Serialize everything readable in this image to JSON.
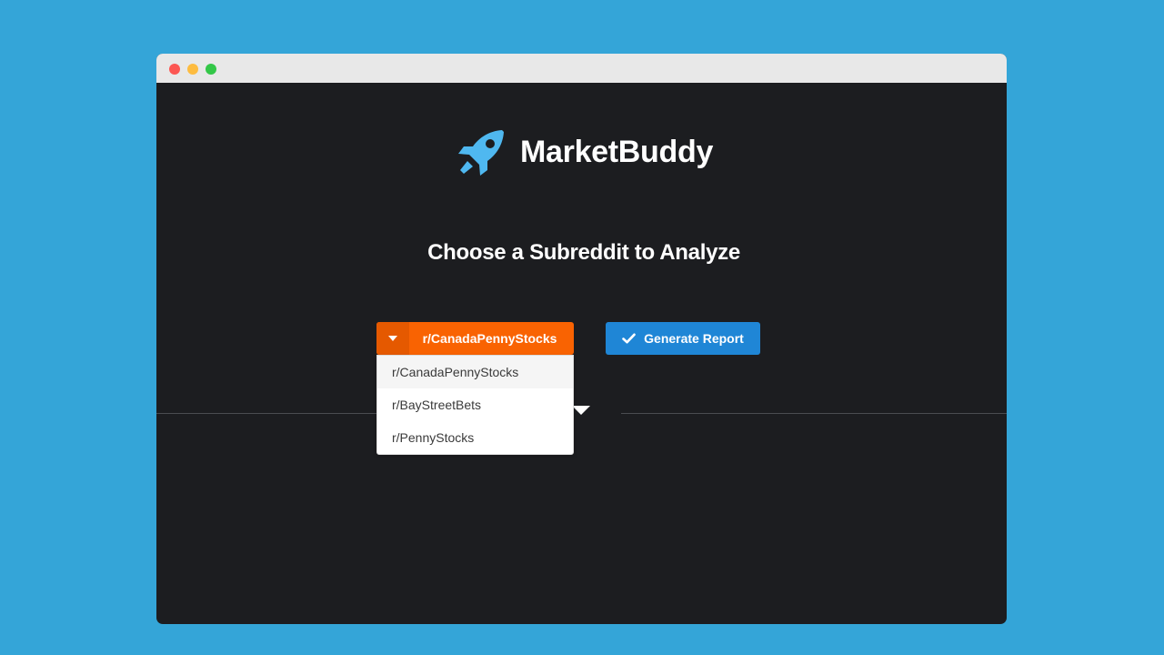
{
  "app": {
    "name": "MarketBuddy",
    "logo_icon": "rocket-icon",
    "brand_color": "#4fb8f0"
  },
  "page": {
    "heading": "Choose a Subreddit to Analyze"
  },
  "subreddit_select": {
    "selected": "r/CanadaPennyStocks",
    "caret_icon": "caret-down-icon",
    "color": "#f96302",
    "options": [
      "r/CanadaPennyStocks",
      "r/BayStreetBets",
      "r/PennyStocks"
    ]
  },
  "generate_button": {
    "label": "Generate Report",
    "icon": "check-icon",
    "color": "#1f86d6"
  }
}
